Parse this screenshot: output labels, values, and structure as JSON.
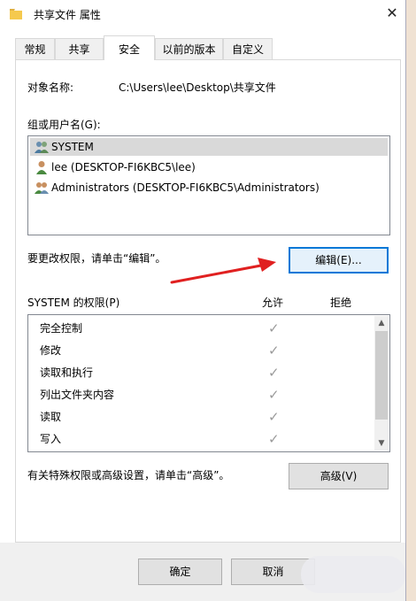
{
  "window": {
    "title": "共享文件 属性"
  },
  "tabs": [
    "常规",
    "共享",
    "安全",
    "以前的版本",
    "自定义"
  ],
  "object_name": {
    "label": "对象名称:",
    "value": "C:\\Users\\lee\\Desktop\\共享文件"
  },
  "groups": {
    "label": "组或用户名(G):",
    "users": [
      {
        "name": "SYSTEM"
      },
      {
        "name": "lee (DESKTOP-FI6KBC5\\lee)"
      },
      {
        "name": "Administrators (DESKTOP-FI6KBC5\\Administrators)"
      }
    ]
  },
  "change_hint": "要更改权限，请单击“编辑”。",
  "edit_button": "编辑(E)...",
  "permissions": {
    "title": "SYSTEM 的权限(P)",
    "allow": "允许",
    "deny": "拒绝",
    "items": [
      {
        "name": "完全控制",
        "allow": true
      },
      {
        "name": "修改",
        "allow": true
      },
      {
        "name": "读取和执行",
        "allow": true
      },
      {
        "name": "列出文件夹内容",
        "allow": true
      },
      {
        "name": "读取",
        "allow": true
      },
      {
        "name": "写入",
        "allow": true
      }
    ]
  },
  "advanced_hint": "有关特殊权限或高级设置，请单击“高级”。",
  "advanced_button": "高级(V)",
  "footer": {
    "ok": "确定",
    "cancel": "取消"
  },
  "icons": {
    "folder": "folder-icon",
    "close": "close-icon",
    "group_user": "group-users-icon",
    "single_user": "user-icon",
    "check": "checkmark-icon",
    "arrow": "red-arrow-annotation"
  },
  "colors": {
    "arrow": "#e02020",
    "selection": "#d9d9d9",
    "focus": "#0078d7"
  }
}
